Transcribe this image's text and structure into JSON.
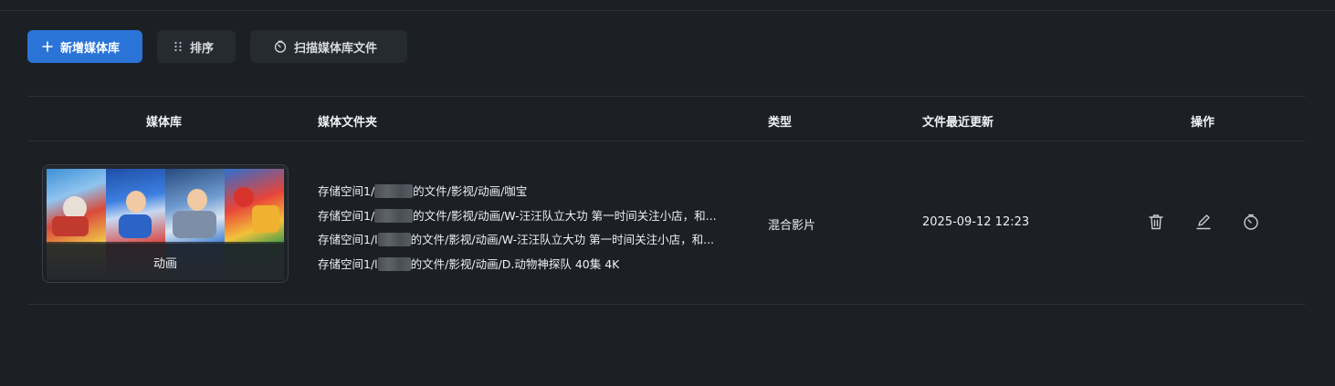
{
  "toolbar": {
    "add_label": "新增媒体库",
    "add_icon": "plus-icon",
    "sort_label": "排序",
    "sort_icon": "drag-dots-icon",
    "scan_label": "扫描媒体库文件",
    "scan_icon": "scan-timer-icon",
    "accent_color": "#2a74d8"
  },
  "table": {
    "columns": {
      "library": "媒体库",
      "folders": "媒体文件夹",
      "type": "类型",
      "updated": "文件最近更新",
      "actions": "操作"
    },
    "rows": [
      {
        "library_name": "动画",
        "folders": [
          {
            "prefix": "存储空间1/",
            "suffix": "的文件/影视/动画/咖宝"
          },
          {
            "prefix": "存储空间1/",
            "suffix": "的文件/影视/动画/W-汪汪队立大功 第一时间关注小店，和..."
          },
          {
            "prefix": "存储空间1/l",
            "suffix": "的文件/影视/动画/W-汪汪队立大功 第一时间关注小店，和..."
          },
          {
            "prefix": "存储空间1/l",
            "suffix": "的文件/影视/动画/D.动物神探队 40集 4K"
          }
        ],
        "type": "混合影片",
        "updated": "2025-09-12 12:23",
        "actions": [
          "trash-icon",
          "edit-icon",
          "scan-timer-icon"
        ]
      }
    ]
  }
}
